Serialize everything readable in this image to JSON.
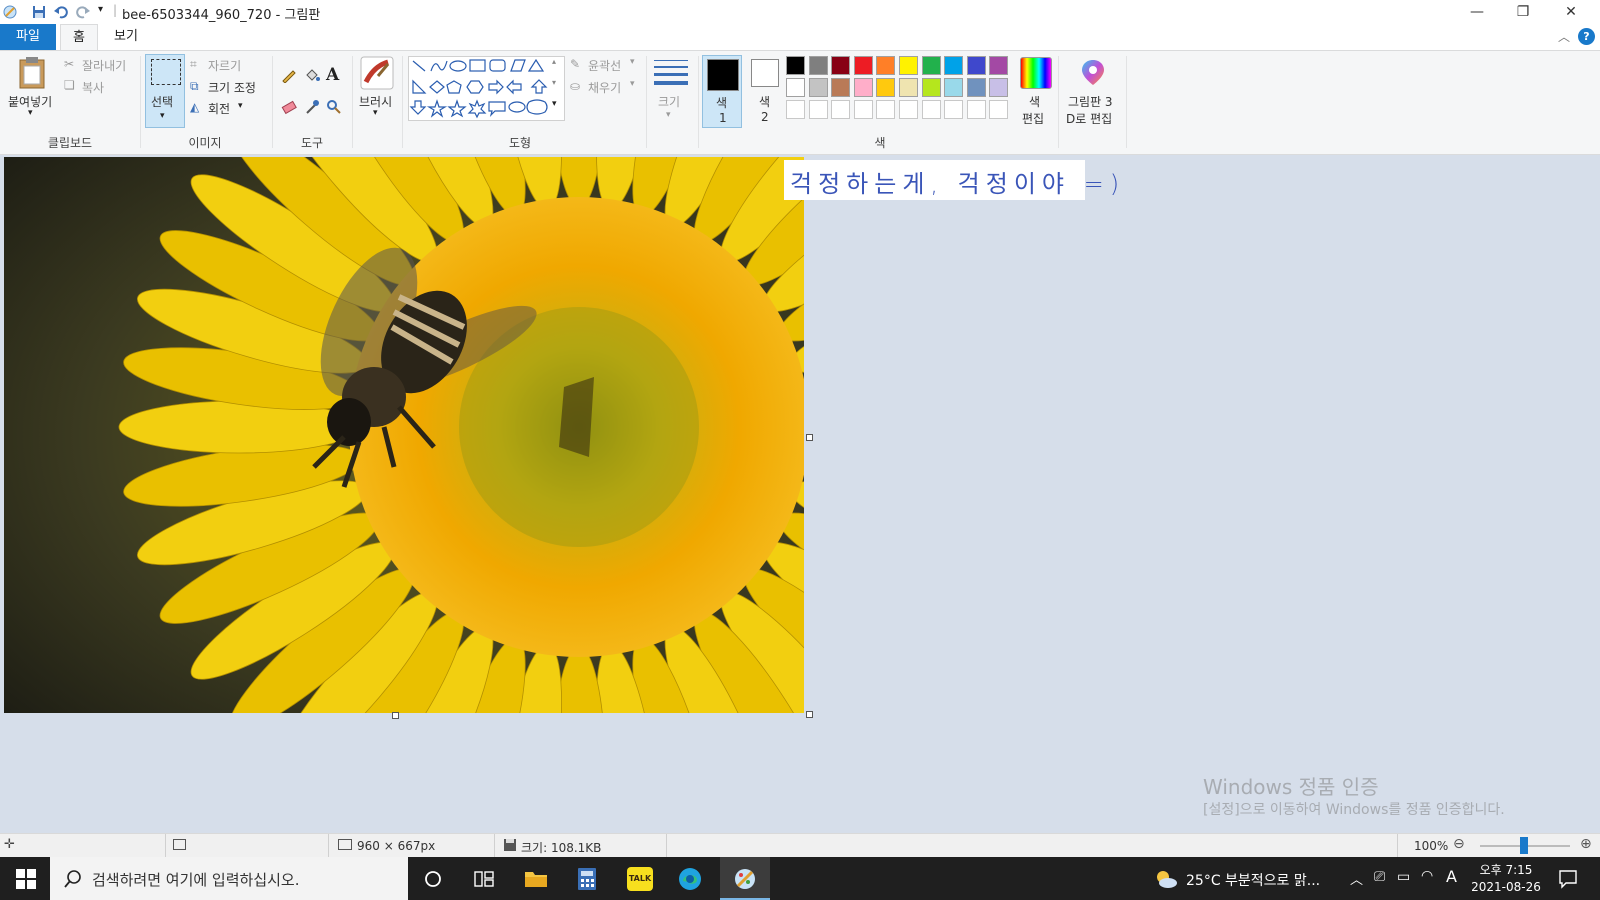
{
  "window": {
    "title": "bee-6503344_960_720 - 그림판"
  },
  "tabs": [
    "파일",
    "홈",
    "보기"
  ],
  "ribbon": {
    "clipboard": {
      "paste": "붙여넣기",
      "cut": "잘라내기",
      "copy": "복사",
      "group": "클립보드"
    },
    "image": {
      "select": "선택",
      "crop": "자르기",
      "resize": "크기 조정",
      "rotate": "회전",
      "group": "이미지"
    },
    "tools": {
      "group": "도구"
    },
    "brushes": {
      "label": "브러시"
    },
    "shapes": {
      "outline": "윤곽선",
      "fill": "채우기",
      "group": "도형"
    },
    "size": {
      "label": "크기"
    },
    "colors": {
      "color1": "색\n1",
      "color1_a": "색",
      "color1_b": "1",
      "color2_a": "색",
      "color2_b": "2",
      "edit_a": "색",
      "edit_b": "편집",
      "paint3d_a": "그림판 3",
      "paint3d_b": "D로 편집",
      "group": "색",
      "palette_row1": [
        "#000000",
        "#7f7f7f",
        "#880015",
        "#ed1c24",
        "#ff7f27",
        "#fff200",
        "#22b14c",
        "#00a2e8",
        "#3f48cc",
        "#a349a4"
      ],
      "palette_row2": [
        "#ffffff",
        "#c3c3c3",
        "#b97a57",
        "#ffaec9",
        "#ffc90e",
        "#efe4b0",
        "#b5e61d",
        "#99d9ea",
        "#7092be",
        "#c8bfe7"
      ]
    }
  },
  "canvas": {
    "handwriting": "걱정하는게, 걱정이야 =)"
  },
  "watermark": {
    "line1": "Windows 정품 인증",
    "line2": "[설정]으로 이동하여 Windows를 정품 인증합니다."
  },
  "status": {
    "dimensions": "960 × 667px",
    "size": "크기: 108.1KB",
    "zoom": "100%"
  },
  "taskbar": {
    "search_placeholder": "검색하려면 여기에 입력하십시오.",
    "weather": "25°C  부분적으로 맑...",
    "time": "오후 7:15",
    "date": "2021-08-26",
    "ime": "A",
    "talk": "TALK"
  }
}
